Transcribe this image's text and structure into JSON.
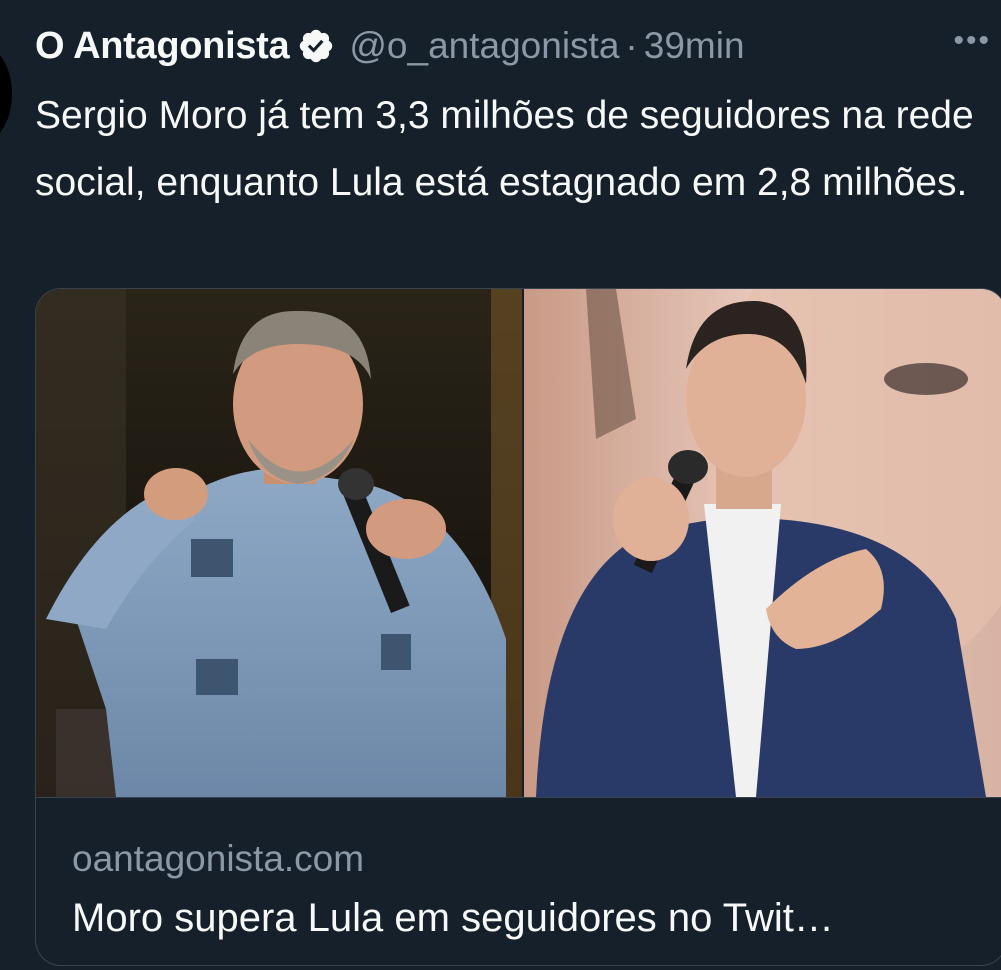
{
  "tweet": {
    "author_name": "O Antagonista",
    "verified": true,
    "handle": "@o_antagonista",
    "separator": "·",
    "time": "39min",
    "more_label": "•••",
    "text": "Sergio Moro já tem 3,3 milhões de seguidores na rede social, enquanto Lula está estagnado em 2,8 milhões."
  },
  "card": {
    "domain": "oantagonista.com",
    "title": "Moro supera Lula em seguidores no Twit…"
  },
  "colors": {
    "background": "#15202b",
    "text_primary": "#f7f9f9",
    "text_secondary": "#8b98a5",
    "border": "#38444d"
  }
}
